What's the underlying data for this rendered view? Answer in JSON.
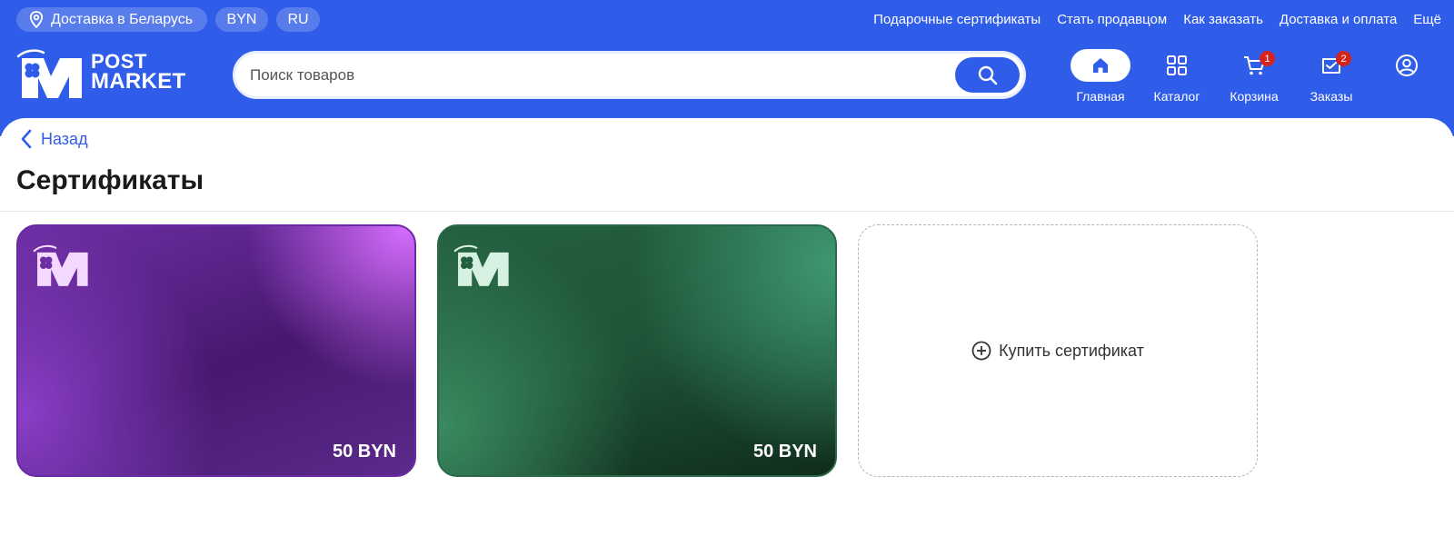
{
  "topbar": {
    "delivery_label": "Доставка в Беларусь",
    "currency": "BYN",
    "language": "RU",
    "links": [
      "Подарочные сертификаты",
      "Стать продавцом",
      "Как заказать",
      "Доставка и оплата",
      "Ещё"
    ]
  },
  "brand": {
    "line1": "POST",
    "line2": "MARKET"
  },
  "search": {
    "placeholder": "Поиск товаров"
  },
  "nav": {
    "home": {
      "label": "Главная",
      "icon": "home-icon"
    },
    "catalog": {
      "label": "Каталог",
      "icon": "grid-icon"
    },
    "cart": {
      "label": "Корзина",
      "icon": "cart-icon",
      "badge": "1"
    },
    "orders": {
      "label": "Заказы",
      "icon": "orders-icon",
      "badge": "2"
    },
    "profile": {
      "icon": "user-icon"
    }
  },
  "page": {
    "back_label": "Назад",
    "title": "Сертификаты"
  },
  "certificates": [
    {
      "amount": "50 BYN",
      "color": "purple"
    },
    {
      "amount": "50 BYN",
      "color": "green"
    }
  ],
  "buy": {
    "label": "Купить сертификат"
  },
  "colors": {
    "primary": "#2f5ce8",
    "badge": "#d4251c"
  }
}
